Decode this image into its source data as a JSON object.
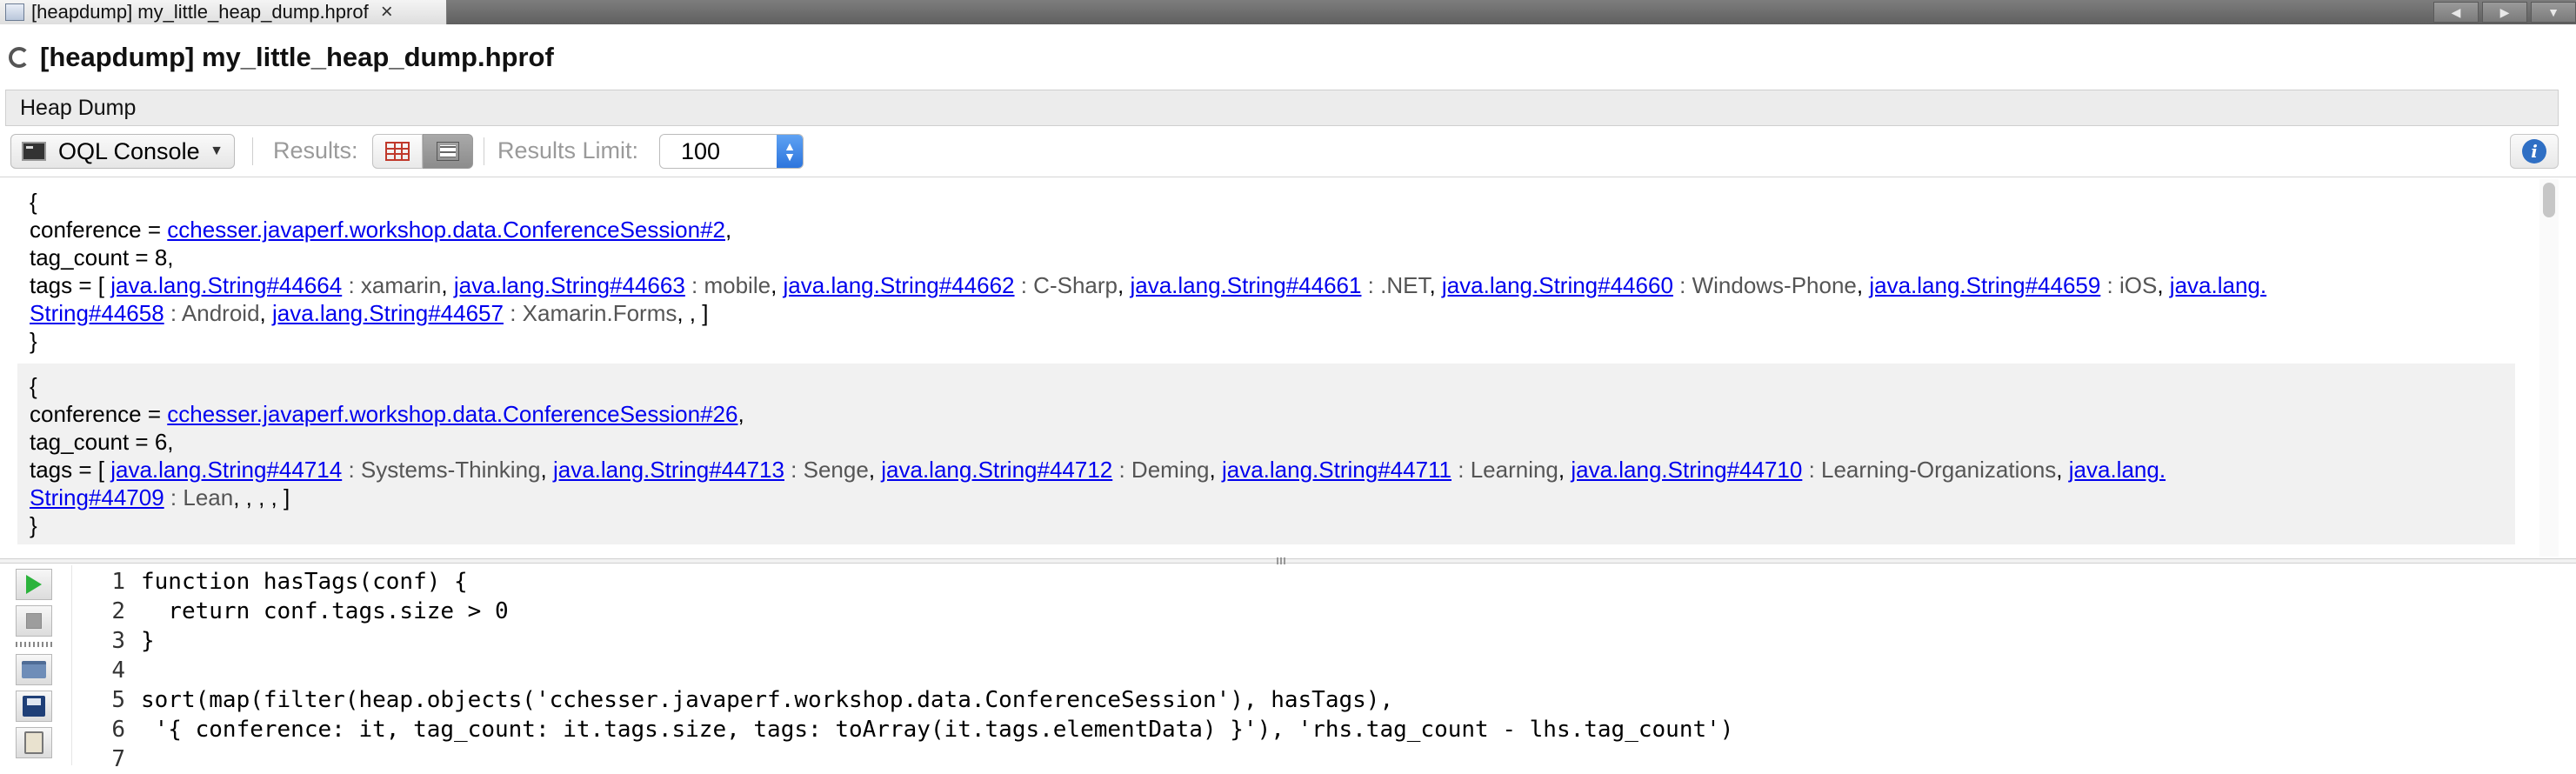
{
  "tab": {
    "title": "[heapdump] my_little_heap_dump.hprof",
    "close": "×"
  },
  "tab_nav": {
    "prev": "◀",
    "next": "▶",
    "menu": "▼"
  },
  "window_title": "[heapdump] my_little_heap_dump.hprof",
  "section_header": "Heap Dump",
  "toolbar": {
    "console_label": "OQL Console",
    "results_label": "Results:",
    "results_limit_label": "Results Limit:",
    "results_limit_value": "100",
    "active_view": "text"
  },
  "results": [
    {
      "open": "{",
      "conference_key": "conference = ",
      "conference_link": "cchesser.javaperf.workshop.data.ConferenceSession#2",
      "conference_tail": ",",
      "tag_count_line": "tag_count = 8,",
      "tags_prefix": "tags = [ ",
      "tags": [
        {
          "ref": "java.lang.String#44664",
          "val": " : xamarin"
        },
        {
          "ref": "java.lang.String#44663",
          "val": " : mobile"
        },
        {
          "ref": "java.lang.String#44662",
          "val": " : C-Sharp"
        },
        {
          "ref": "java.lang.String#44661",
          "val": " : .NET"
        },
        {
          "ref": "java.lang.String#44660",
          "val": " : Windows-Phone"
        },
        {
          "ref": "java.lang.String#44659",
          "val": " : iOS"
        }
      ],
      "wrap_ref_a": "java.lang.",
      "wrap_ref_b": "String#44658",
      "wrap_val": " : Android",
      "last_ref": "java.lang.String#44657",
      "last_val": " : Xamarin.Forms",
      "tags_suffix": ", ,  ]",
      "close": "}"
    },
    {
      "open": "{",
      "conference_key": "conference = ",
      "conference_link": "cchesser.javaperf.workshop.data.ConferenceSession#26",
      "conference_tail": ",",
      "tag_count_line": "tag_count = 6,",
      "tags_prefix": "tags = [ ",
      "tags": [
        {
          "ref": "java.lang.String#44714",
          "val": " : Systems-Thinking"
        },
        {
          "ref": "java.lang.String#44713",
          "val": " : Senge"
        },
        {
          "ref": "java.lang.String#44712",
          "val": " : Deming"
        },
        {
          "ref": "java.lang.String#44711",
          "val": " : Learning"
        },
        {
          "ref": "java.lang.String#44710",
          "val": " : Learning-Organizations"
        }
      ],
      "wrap_ref_a": "java.lang.",
      "wrap_ref_b": "String#44709",
      "wrap_val": " : Lean",
      "tags_suffix": ", , , ,  ]",
      "close": "}"
    }
  ],
  "editor": {
    "lines": [
      {
        "n": "1",
        "code": "function hasTags(conf) {"
      },
      {
        "n": "2",
        "code": "  return conf.tags.size > 0"
      },
      {
        "n": "3",
        "code": "}"
      },
      {
        "n": "4",
        "code": ""
      },
      {
        "n": "5",
        "code": "sort(map(filter(heap.objects('cchesser.javaperf.workshop.data.ConferenceSession'), hasTags),"
      },
      {
        "n": "6",
        "code": " '{ conference: it, tag_count: it.tags.size, tags: toArray(it.tags.elementData) }'), 'rhs.tag_count - lhs.tag_count')"
      },
      {
        "n": "7",
        "code": ""
      }
    ]
  }
}
